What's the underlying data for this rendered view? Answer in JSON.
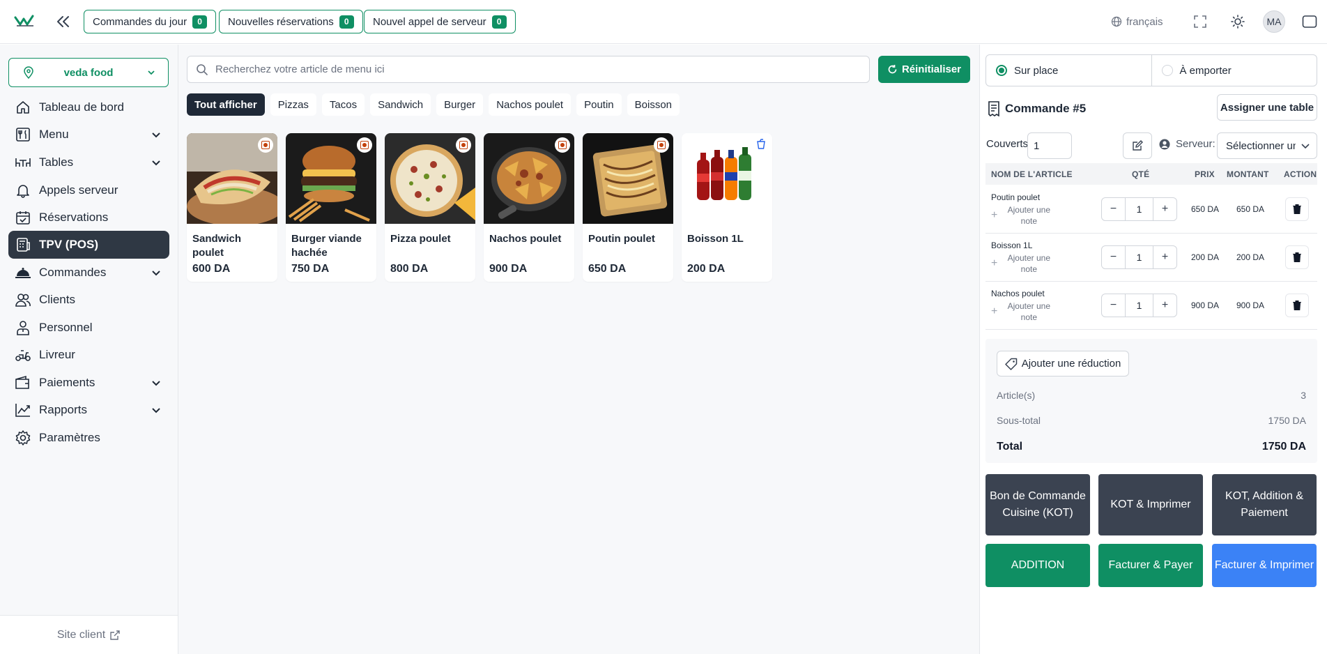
{
  "header": {
    "pills": [
      {
        "label": "Commandes du jour",
        "count": "0"
      },
      {
        "label": "Nouvelles réservations",
        "count": "0"
      },
      {
        "label": "Nouvel appel de serveur",
        "count": "0"
      }
    ],
    "language": "français",
    "avatar": "MA"
  },
  "sidebar": {
    "store": "veda food",
    "items": [
      {
        "label": "Tableau de bord",
        "icon": "home-icon",
        "has_chevron": false
      },
      {
        "label": "Menu",
        "icon": "menu-utensils-icon",
        "has_chevron": true
      },
      {
        "label": "Tables",
        "icon": "tables-icon",
        "has_chevron": true
      },
      {
        "label": "Appels serveur",
        "icon": "bell-icon",
        "has_chevron": false
      },
      {
        "label": "Réservations",
        "icon": "calendar-check-icon",
        "has_chevron": false
      },
      {
        "label": "TPV (POS)",
        "icon": "pos-icon",
        "has_chevron": false,
        "active": true
      },
      {
        "label": "Commandes",
        "icon": "cloche-icon",
        "has_chevron": true
      },
      {
        "label": "Clients",
        "icon": "users-icon",
        "has_chevron": false
      },
      {
        "label": "Personnel",
        "icon": "staff-icon",
        "has_chevron": false
      },
      {
        "label": "Livreur",
        "icon": "scooter-icon",
        "has_chevron": false
      },
      {
        "label": "Paiements",
        "icon": "wallet-icon",
        "has_chevron": true
      },
      {
        "label": "Rapports",
        "icon": "chart-icon",
        "has_chevron": true
      },
      {
        "label": "Paramètres",
        "icon": "gear-icon",
        "has_chevron": false
      }
    ],
    "site_client": "Site client"
  },
  "main": {
    "search_placeholder": "Recherchez votre article de menu ici",
    "reset_label": "Réinitialiser",
    "categories": [
      "Tout afficher",
      "Pizzas",
      "Tacos",
      "Sandwich",
      "Burger",
      "Nachos poulet",
      "Poutin",
      "Boisson"
    ],
    "active_category": "Tout afficher",
    "products": [
      {
        "name": "Sandwich poulet",
        "price": "600 DA",
        "badge": "non-veg"
      },
      {
        "name": "Burger viande hachée",
        "price": "750 DA",
        "badge": "non-veg"
      },
      {
        "name": "Pizza poulet",
        "price": "800 DA",
        "badge": "non-veg"
      },
      {
        "name": "Nachos poulet",
        "price": "900 DA",
        "badge": "non-veg"
      },
      {
        "name": "Poutin poulet",
        "price": "650 DA",
        "badge": "non-veg"
      },
      {
        "name": "Boisson 1L",
        "price": "200 DA",
        "badge": "drink"
      }
    ]
  },
  "order": {
    "type_options": [
      "Sur place",
      "À emporter"
    ],
    "selected_type": "Sur place",
    "title": "Commande #5",
    "assign_table": "Assigner une table",
    "couverts_label": "Couverts",
    "couverts_value": "1",
    "server_label": "Serveur:",
    "server_select": "Sélectionner un serveur",
    "columns": [
      "NOM DE L'ARTICLE",
      "QTÉ",
      "PRIX",
      "MONTANT",
      "ACTION"
    ],
    "items": [
      {
        "name": "Poutin poulet",
        "note": "Ajouter une note",
        "qty": "1",
        "price": "650 DA",
        "amount": "650 DA"
      },
      {
        "name": "Boisson 1L",
        "note": "Ajouter une note",
        "qty": "1",
        "price": "200 DA",
        "amount": "200 DA"
      },
      {
        "name": "Nachos poulet",
        "note": "Ajouter une note",
        "qty": "1",
        "price": "900 DA",
        "amount": "900 DA"
      }
    ],
    "discount_label": "Ajouter une réduction",
    "summary": {
      "articles_label": "Article(s)",
      "articles_value": "3",
      "subtotal_label": "Sous-total",
      "subtotal_value": "1750 DA",
      "total_label": "Total",
      "total_value": "1750 DA"
    },
    "actions": {
      "kot": "Bon de Commande Cuisine (KOT)",
      "kot_print": "KOT & Imprimer",
      "kot_bill_pay": "KOT, Addition & Paiement",
      "addition": "ADDITION",
      "bill_pay": "Facturer & Payer",
      "bill_print": "Facturer & Imprimer"
    }
  },
  "colors": {
    "brand_green": "#0f8f63",
    "dark": "#3b4351",
    "blue": "#3b82f6",
    "nonveg": "#c2410c"
  }
}
